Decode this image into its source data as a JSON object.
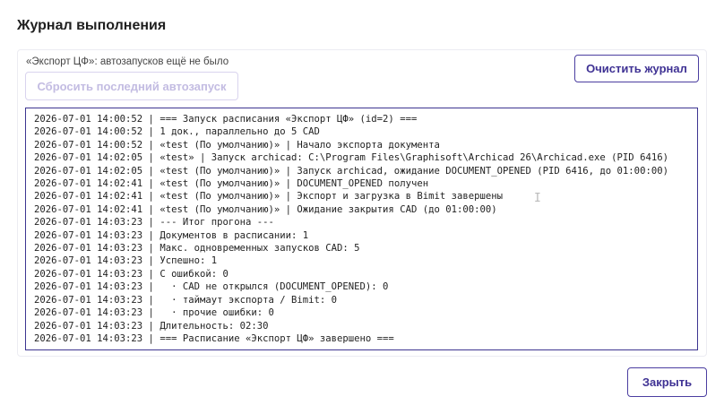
{
  "dialog": {
    "title": "Журнал выполнения"
  },
  "panel": {
    "status_text": "«Экспорт ЦФ»: автозапусков ещё не было",
    "clear_button_label": "Очистить журнал",
    "reset_button_label": "Сбросить последний автозапуск",
    "reset_button_disabled": true
  },
  "log": {
    "lines": [
      "2026-07-01 14:00:52 | === Запуск расписания «Экспорт ЦФ» (id=2) ===",
      "2026-07-01 14:00:52 | 1 док., параллельно до 5 CAD",
      "2026-07-01 14:00:52 | «test (По умолчанию)» | Начало экспорта документа",
      "2026-07-01 14:02:05 | «test» | Запуск archicad: C:\\Program Files\\Graphisoft\\Archicad 26\\Archicad.exe (PID 6416)",
      "2026-07-01 14:02:05 | «test (По умолчанию)» | Запуск archicad, ожидание DOCUMENT_OPENED (PID 6416, до 01:00:00)",
      "2026-07-01 14:02:41 | «test (По умолчанию)» | DOCUMENT_OPENED получен",
      "2026-07-01 14:02:41 | «test (По умолчанию)» | Экспорт и загрузка в Bimit завершены",
      "2026-07-01 14:02:41 | «test (По умолчанию)» | Ожидание закрытия CAD (до 01:00:00)",
      "2026-07-01 14:03:23 | --- Итог прогона ---",
      "2026-07-01 14:03:23 | Документов в расписании: 1",
      "2026-07-01 14:03:23 | Макс. одновременных запусков CAD: 5",
      "2026-07-01 14:03:23 | Успешно: 1",
      "2026-07-01 14:03:23 | С ошибкой: 0",
      "2026-07-01 14:03:23 |   · CAD не открылся (DOCUMENT_OPENED): 0",
      "2026-07-01 14:03:23 |   · таймаут экспорта / Bimit: 0",
      "2026-07-01 14:03:23 |   · прочие ошибки: 0",
      "2026-07-01 14:03:23 | Длительность: 02:30",
      "2026-07-01 14:03:23 | === Расписание «Экспорт ЦФ» завершено ==="
    ]
  },
  "footer": {
    "close_button_label": "Закрыть"
  },
  "colors": {
    "accent": "#3f3294",
    "accent_border": "#4b3ea0",
    "disabled_text": "#c3bce2",
    "log_border": "#3d3591"
  }
}
